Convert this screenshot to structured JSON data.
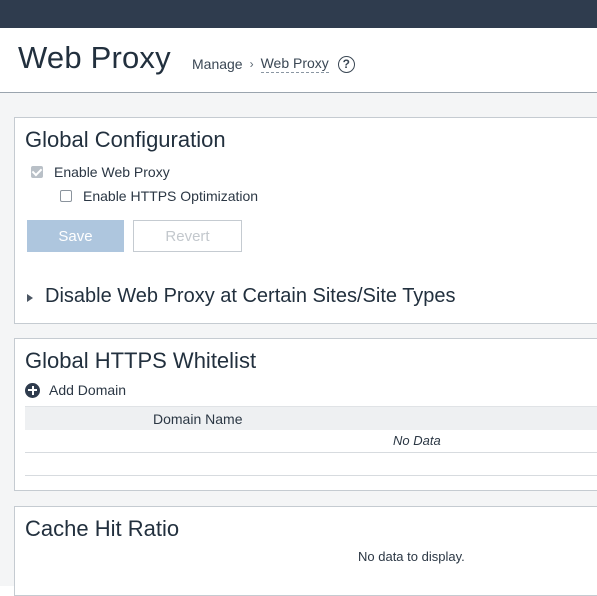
{
  "page": {
    "title": "Web Proxy",
    "breadcrumb": {
      "parent": "Manage",
      "separator": "›",
      "current": "Web Proxy"
    },
    "help_icon_glyph": "?"
  },
  "global_config": {
    "title": "Global Configuration",
    "enable_web_proxy": {
      "label": "Enable Web Proxy",
      "checked": true
    },
    "enable_https_opt": {
      "label": "Enable HTTPS Optimization",
      "checked": false
    },
    "save_label": "Save",
    "revert_label": "Revert",
    "disable_sites_label": "Disable Web Proxy at Certain Sites/Site Types"
  },
  "whitelist": {
    "title": "Global HTTPS Whitelist",
    "add_domain_label": "Add Domain",
    "column_header": "Domain Name",
    "empty_text": "No Data"
  },
  "cache": {
    "title": "Cache Hit Ratio",
    "empty_text": "No data to display."
  },
  "colors": {
    "topbar": "#2f3c4e",
    "save_button": "#aec6de",
    "text": "#22303e"
  }
}
